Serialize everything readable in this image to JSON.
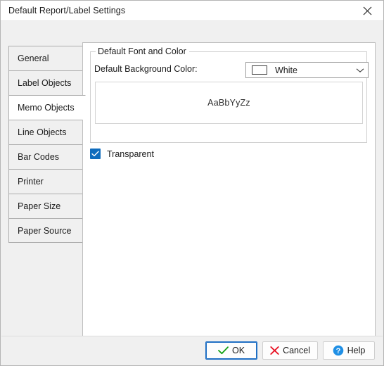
{
  "window": {
    "title": "Default Report/Label Settings",
    "close_icon": "close-icon"
  },
  "tabs": [
    {
      "label": "General",
      "selected": false
    },
    {
      "label": "Label Objects",
      "selected": false
    },
    {
      "label": "Memo Objects",
      "selected": true
    },
    {
      "label": "Line Objects",
      "selected": false
    },
    {
      "label": "Bar Codes",
      "selected": false
    },
    {
      "label": "Printer",
      "selected": false
    },
    {
      "label": "Paper Size",
      "selected": false
    },
    {
      "label": "Paper Source",
      "selected": false
    }
  ],
  "content": {
    "group_title": "Default Font and Color",
    "background_color_label": "Default Background Color:",
    "background_color_value": "White",
    "background_color_swatch": "#ffffff",
    "dropdown_icon": "chevron-down-icon",
    "preview_text": "AaBbYyZz",
    "transparent_label": "Transparent",
    "transparent_checked": true
  },
  "footer": {
    "ok_label": "OK",
    "ok_icon": "check-icon",
    "cancel_label": "Cancel",
    "cancel_icon": "x-icon",
    "help_label": "Help",
    "help_icon": "question-circle-icon"
  },
  "colors": {
    "accent": "#0f6cbd",
    "ok_check": "#12a112",
    "cancel_x": "#e81123",
    "help_circle": "#1f8fe5",
    "focus_border": "#1f6fc4"
  }
}
